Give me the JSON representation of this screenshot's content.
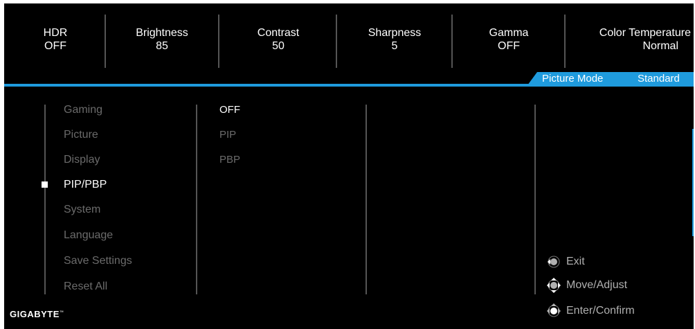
{
  "status_bar": [
    {
      "label": "HDR",
      "value": "OFF"
    },
    {
      "label": "Brightness",
      "value": "85"
    },
    {
      "label": "Contrast",
      "value": "50"
    },
    {
      "label": "Sharpness",
      "value": "5"
    },
    {
      "label": "Gamma",
      "value": "OFF"
    },
    {
      "label": "Color Temperature",
      "value": "Normal"
    }
  ],
  "picture_mode": {
    "label": "Picture Mode",
    "value": "Standard"
  },
  "menu": {
    "items": [
      "Gaming",
      "Picture",
      "Display",
      "PIP/PBP",
      "System",
      "Language",
      "Save Settings",
      "Reset All"
    ],
    "selected": "PIP/PBP"
  },
  "submenu": {
    "items": [
      "OFF",
      "PIP",
      "PBP"
    ],
    "selected": "OFF"
  },
  "hints": [
    {
      "icon": "joystick-left-icon",
      "label": "Exit"
    },
    {
      "icon": "joystick-updown-icon",
      "label": "Move/Adjust"
    },
    {
      "icon": "joystick-press-icon",
      "label": "Enter/Confirm"
    }
  ],
  "brand": {
    "logo": "GIGABYTE",
    "trademark": "™"
  },
  "colors": {
    "accent": "#1f9bdd",
    "background": "#000000",
    "inactive_text": "#6b6b6b",
    "active_text": "#ffffff"
  }
}
